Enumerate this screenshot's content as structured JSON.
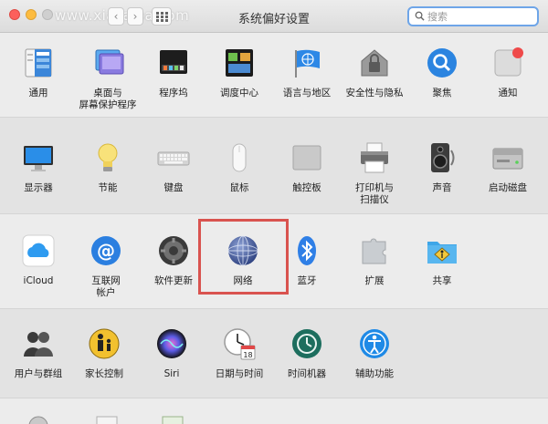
{
  "window": {
    "title": "系统偏好设置",
    "watermark": "www.xiazaiba.com"
  },
  "search": {
    "placeholder": "搜索",
    "value": ""
  },
  "sections": [
    {
      "items": [
        {
          "id": "general",
          "label": "通用",
          "icon": "general-icon"
        },
        {
          "id": "desktop",
          "label": "桌面与\n屏幕保护程序",
          "icon": "desktop-screensaver-icon"
        },
        {
          "id": "dock",
          "label": "程序坞",
          "icon": "dock-icon"
        },
        {
          "id": "mission",
          "label": "调度中心",
          "icon": "mission-control-icon"
        },
        {
          "id": "language",
          "label": "语言与地区",
          "icon": "language-region-icon"
        },
        {
          "id": "security",
          "label": "安全性与隐私",
          "icon": "security-privacy-icon"
        },
        {
          "id": "spotlight",
          "label": "聚焦",
          "icon": "spotlight-icon"
        },
        {
          "id": "notifications",
          "label": "通知",
          "icon": "notifications-icon"
        }
      ]
    },
    {
      "items": [
        {
          "id": "displays",
          "label": "显示器",
          "icon": "displays-icon"
        },
        {
          "id": "energy",
          "label": "节能",
          "icon": "energy-saver-icon"
        },
        {
          "id": "keyboard",
          "label": "键盘",
          "icon": "keyboard-icon"
        },
        {
          "id": "mouse",
          "label": "鼠标",
          "icon": "mouse-icon"
        },
        {
          "id": "trackpad",
          "label": "触控板",
          "icon": "trackpad-icon"
        },
        {
          "id": "printers",
          "label": "打印机与\n扫描仪",
          "icon": "printers-scanners-icon"
        },
        {
          "id": "sound",
          "label": "声音",
          "icon": "sound-icon"
        },
        {
          "id": "startup",
          "label": "启动磁盘",
          "icon": "startup-disk-icon"
        }
      ]
    },
    {
      "items": [
        {
          "id": "icloud",
          "label": "iCloud",
          "icon": "icloud-icon"
        },
        {
          "id": "internet",
          "label": "互联网\n帐户",
          "icon": "internet-accounts-icon"
        },
        {
          "id": "update",
          "label": "软件更新",
          "icon": "software-update-icon"
        },
        {
          "id": "network",
          "label": "网络",
          "icon": "network-icon"
        },
        {
          "id": "bluetooth",
          "label": "蓝牙",
          "icon": "bluetooth-icon"
        },
        {
          "id": "extensions",
          "label": "扩展",
          "icon": "extensions-icon"
        },
        {
          "id": "sharing",
          "label": "共享",
          "icon": "sharing-icon"
        }
      ]
    },
    {
      "items": [
        {
          "id": "users",
          "label": "用户与群组",
          "icon": "users-groups-icon"
        },
        {
          "id": "parental",
          "label": "家长控制",
          "icon": "parental-controls-icon"
        },
        {
          "id": "siri",
          "label": "Siri",
          "icon": "siri-icon"
        },
        {
          "id": "datetime",
          "label": "日期与时间",
          "icon": "date-time-icon"
        },
        {
          "id": "timemachine",
          "label": "时间机器",
          "icon": "time-machine-icon"
        },
        {
          "id": "accessibility",
          "label": "辅助功能",
          "icon": "accessibility-icon"
        }
      ]
    }
  ],
  "datetime_icon_day": "18",
  "colors": {
    "highlight": "#d9534f",
    "search_focus": "#6ea5e8"
  }
}
